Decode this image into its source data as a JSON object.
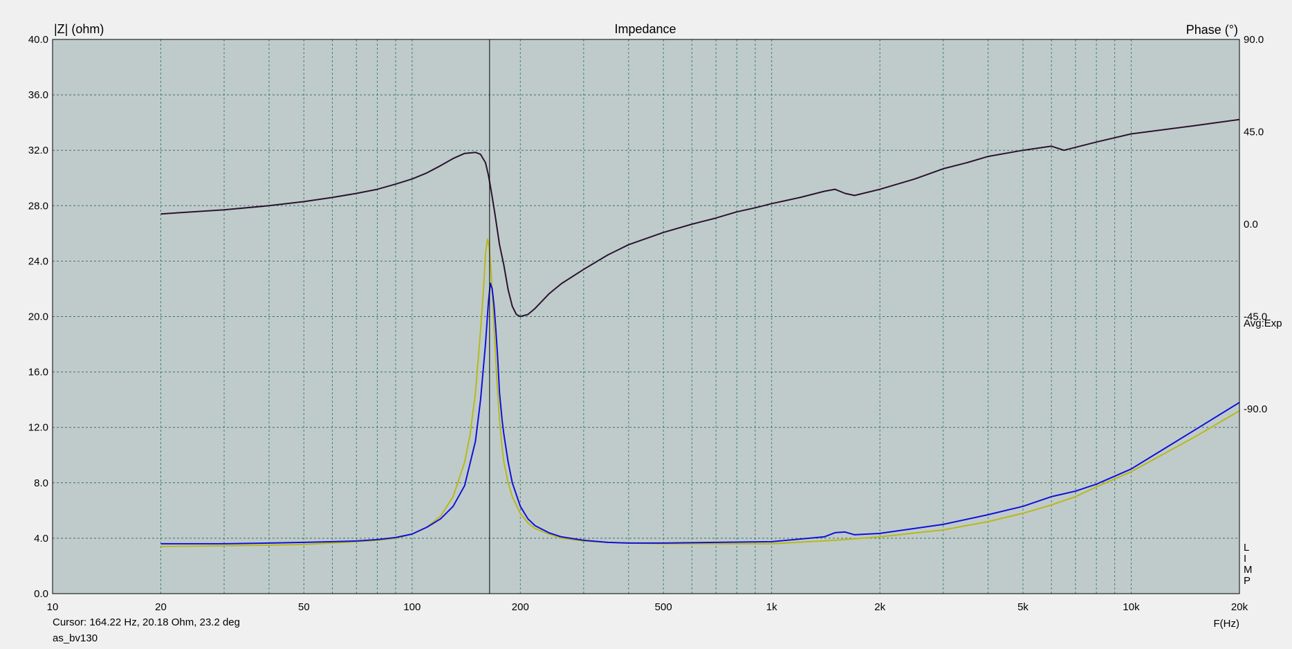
{
  "chart_data": {
    "type": "line",
    "title": "Impedance",
    "ylabel_left": "|Z| (ohm)",
    "ylabel_right": "Phase (°)",
    "xlabel": "F(Hz)",
    "xscale": "log",
    "xlim": [
      10,
      20000
    ],
    "ylim_left": [
      0,
      40
    ],
    "ylim_right": [
      -180,
      90
    ],
    "grid": true,
    "x_ticks": [
      {
        "value": 10,
        "label": "10"
      },
      {
        "value": 20,
        "label": "20"
      },
      {
        "value": 50,
        "label": "50"
      },
      {
        "value": 100,
        "label": "100"
      },
      {
        "value": 200,
        "label": "200"
      },
      {
        "value": 500,
        "label": "500"
      },
      {
        "value": 1000,
        "label": "1k"
      },
      {
        "value": 2000,
        "label": "2k"
      },
      {
        "value": 5000,
        "label": "5k"
      },
      {
        "value": 10000,
        "label": "10k"
      },
      {
        "value": 20000,
        "label": "20k"
      }
    ],
    "y_left_ticks": [
      "0.0",
      "4.0",
      "8.0",
      "12.0",
      "16.0",
      "20.0",
      "24.0",
      "28.0",
      "32.0",
      "36.0",
      "40.0"
    ],
    "y_right_ticks": [
      {
        "value": 90,
        "label": "90.0"
      },
      {
        "value": 45,
        "label": "45.0"
      },
      {
        "value": 0,
        "label": "0.0"
      },
      {
        "value": -45,
        "label": "-45.0"
      },
      {
        "value": -90,
        "label": "-90.0"
      }
    ],
    "annotation_right": "Avg:Exp",
    "annotation_vertical": [
      "L",
      "I",
      "M",
      "P"
    ],
    "cursor_x": 164.22,
    "series": [
      {
        "color": "#2a1230",
        "axis": "right",
        "x": [
          20,
          30,
          40,
          50,
          60,
          70,
          80,
          90,
          100,
          110,
          120,
          130,
          140,
          150,
          155,
          160,
          163,
          166,
          170,
          175,
          180,
          185,
          190,
          195,
          200,
          210,
          220,
          240,
          260,
          300,
          350,
          400,
          500,
          600,
          700,
          800,
          900,
          1000,
          1200,
          1400,
          1500,
          1600,
          1700,
          2000,
          2500,
          3000,
          3500,
          4000,
          5000,
          6000,
          6500,
          8000,
          10000,
          15000,
          20000
        ],
        "y": [
          5,
          7,
          9,
          11,
          13,
          15,
          17,
          19.5,
          22,
          25,
          28.5,
          32,
          34.5,
          35,
          34,
          30,
          24,
          16,
          5,
          -10,
          -20,
          -32,
          -40,
          -44,
          -45,
          -44,
          -41,
          -34,
          -29,
          -22,
          -15,
          -10,
          -4,
          0,
          3,
          6,
          8,
          10,
          13,
          16,
          17,
          15,
          14,
          17,
          22,
          27,
          30,
          33,
          36,
          38,
          36,
          40,
          44,
          48,
          51
        ]
      },
      {
        "color": "#b8b81a",
        "axis": "left",
        "x": [
          20,
          30,
          40,
          50,
          60,
          70,
          80,
          90,
          100,
          110,
          120,
          130,
          140,
          145,
          150,
          155,
          158,
          160,
          162,
          164,
          166,
          168,
          170,
          172,
          175,
          178,
          180,
          185,
          190,
          200,
          210,
          220,
          240,
          260,
          300,
          350,
          400,
          500,
          700,
          1000,
          1500,
          2000,
          3000,
          4000,
          5000,
          6000,
          7000,
          8000,
          10000,
          15000,
          20000
        ],
        "y": [
          3.4,
          3.45,
          3.5,
          3.55,
          3.65,
          3.75,
          3.85,
          4.0,
          4.3,
          4.8,
          5.6,
          7.0,
          9.5,
          11.5,
          14.5,
          19.0,
          22.0,
          24.5,
          25.6,
          25.0,
          23.0,
          20.5,
          18.0,
          15.5,
          12.5,
          10.5,
          9.5,
          8.0,
          7.0,
          5.8,
          5.1,
          4.7,
          4.3,
          4.0,
          3.8,
          3.7,
          3.65,
          3.6,
          3.6,
          3.6,
          3.85,
          4.1,
          4.6,
          5.2,
          5.8,
          6.4,
          7.0,
          7.7,
          8.8,
          11.3,
          13.2
        ]
      },
      {
        "color": "#1010d8",
        "axis": "left",
        "x": [
          20,
          30,
          40,
          50,
          60,
          70,
          80,
          90,
          100,
          110,
          120,
          130,
          140,
          150,
          155,
          160,
          163,
          165,
          167,
          169,
          171,
          173,
          175,
          178,
          180,
          185,
          190,
          200,
          210,
          220,
          240,
          260,
          300,
          350,
          400,
          500,
          700,
          1000,
          1400,
          1500,
          1600,
          1700,
          2000,
          3000,
          4000,
          5000,
          6000,
          7000,
          8000,
          10000,
          15000,
          20000
        ],
        "y": [
          3.6,
          3.6,
          3.65,
          3.7,
          3.75,
          3.8,
          3.9,
          4.05,
          4.3,
          4.8,
          5.4,
          6.3,
          7.8,
          11.0,
          14.0,
          18.0,
          21.0,
          22.4,
          22.0,
          20.8,
          19.0,
          17.0,
          14.5,
          12.5,
          11.5,
          9.5,
          8.0,
          6.3,
          5.4,
          4.9,
          4.4,
          4.1,
          3.85,
          3.7,
          3.65,
          3.65,
          3.7,
          3.75,
          4.1,
          4.4,
          4.45,
          4.25,
          4.35,
          5.0,
          5.7,
          6.3,
          7.0,
          7.4,
          7.9,
          9.0,
          11.8,
          13.8
        ]
      }
    ]
  },
  "status": {
    "cursor": "Cursor: 164.22 Hz, 20.18 Ohm, 23.2 deg",
    "file": "as_bv130"
  }
}
